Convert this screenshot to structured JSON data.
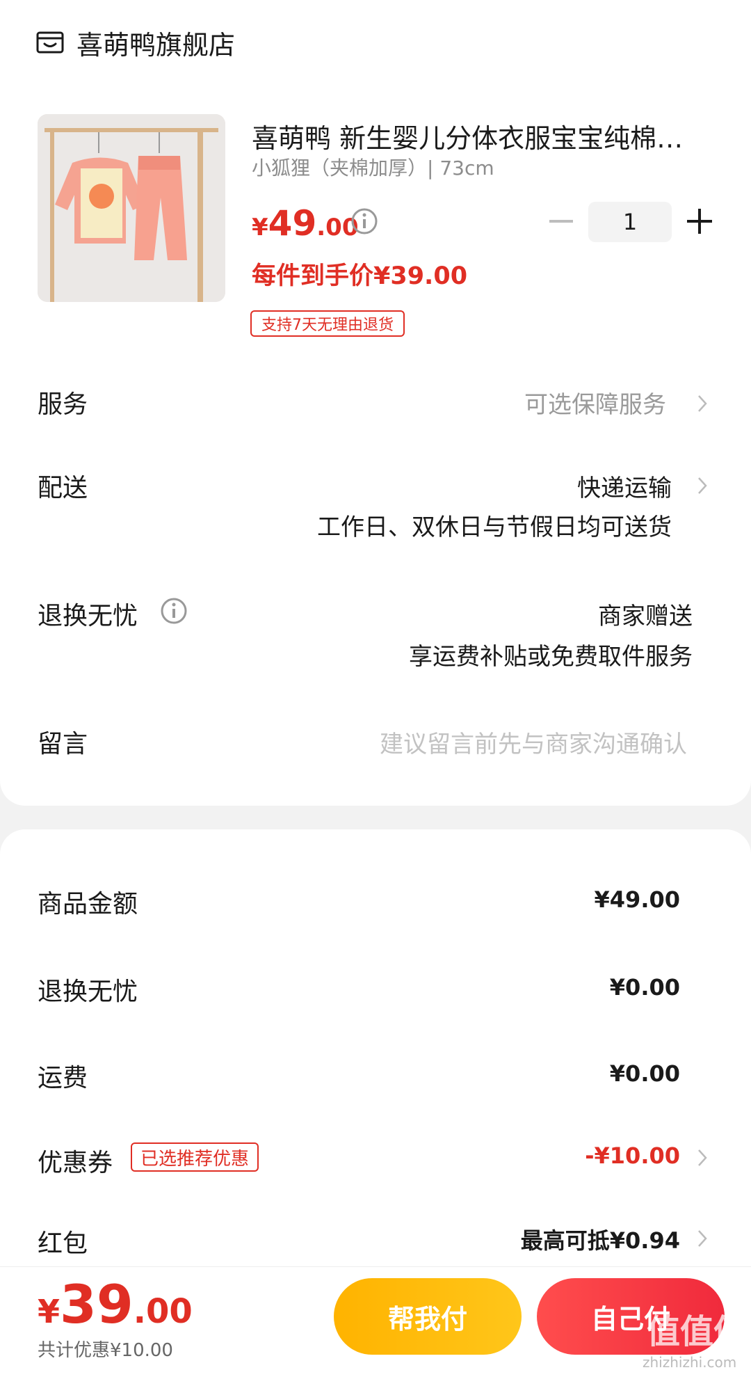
{
  "store": {
    "name": "喜萌鸭旗舰店",
    "icon": "store-icon"
  },
  "product": {
    "title": "喜萌鸭 新生婴儿分体衣服宝宝纯棉…",
    "spec": "小狐狸（夹棉加厚）| 73cm",
    "price_currency": "¥",
    "price_int": "49",
    "price_dec": ".00",
    "quantity": "1",
    "per_price": "每件到手价¥39.00",
    "return_tag": "支持7天无理由退货",
    "image_desc_icon": "baby-outfit-image"
  },
  "rows": {
    "service": {
      "label": "服务",
      "value": "可选保障服务"
    },
    "delivery": {
      "label": "配送",
      "value": "快递运输",
      "note": "工作日、双休日与节假日均可送货"
    },
    "return": {
      "label": "退换无忧",
      "value": "商家赠送",
      "note": "享运费补贴或免费取件服务"
    },
    "message": {
      "label": "留言",
      "placeholder": "建议留言前先与商家沟通确认"
    }
  },
  "summary": {
    "goods": {
      "label": "商品金额",
      "value": "¥49.00"
    },
    "return": {
      "label": "退换无忧",
      "value": "¥0.00"
    },
    "shipping": {
      "label": "运费",
      "value": "¥0.00"
    },
    "coupon": {
      "label": "优惠券",
      "tag": "已选推荐优惠",
      "value": "-¥10.00"
    },
    "redpacket": {
      "label": "红包",
      "value": "最高可抵¥0.94"
    }
  },
  "footer": {
    "total_currency": "¥",
    "total_int": "39",
    "total_dec": ".00",
    "saving": "共计优惠¥10.00",
    "help_pay": "帮我付",
    "self_pay": "自己付",
    "watermark": "值值值",
    "watermark_url": "zhizhizhi.com"
  },
  "colors": {
    "accent": "#e02e24",
    "help_button": "#ffb300",
    "pay_button": "#f02a3c"
  }
}
